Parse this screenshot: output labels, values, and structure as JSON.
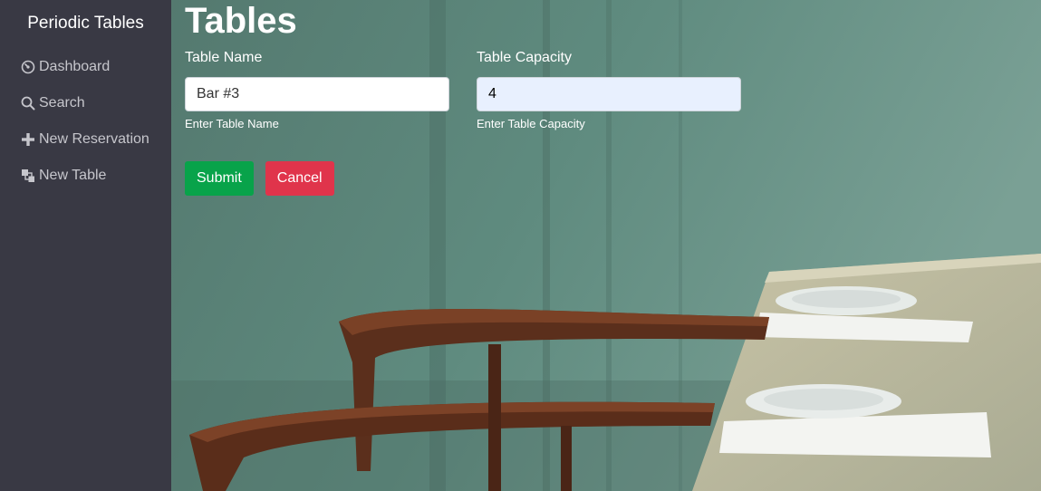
{
  "sidebar": {
    "brand": "Periodic Tables",
    "items": [
      {
        "label": "Dashboard",
        "icon": "dashboard-gauge-icon"
      },
      {
        "label": "Search",
        "icon": "search-icon"
      },
      {
        "label": "New Reservation",
        "icon": "plus-icon"
      },
      {
        "label": "New Table",
        "icon": "layers-icon"
      }
    ]
  },
  "main": {
    "title": "Tables",
    "form": {
      "table_name": {
        "label": "Table Name",
        "value": "Bar #3",
        "help": "Enter Table Name"
      },
      "table_capacity": {
        "label": "Table Capacity",
        "value": "4",
        "help": "Enter Table Capacity"
      },
      "submit_label": "Submit",
      "cancel_label": "Cancel"
    }
  },
  "colors": {
    "sidebar_bg": "#393944",
    "submit": "#08a34a",
    "cancel": "#e0344b",
    "autofill_bg": "#e8f0fe"
  }
}
